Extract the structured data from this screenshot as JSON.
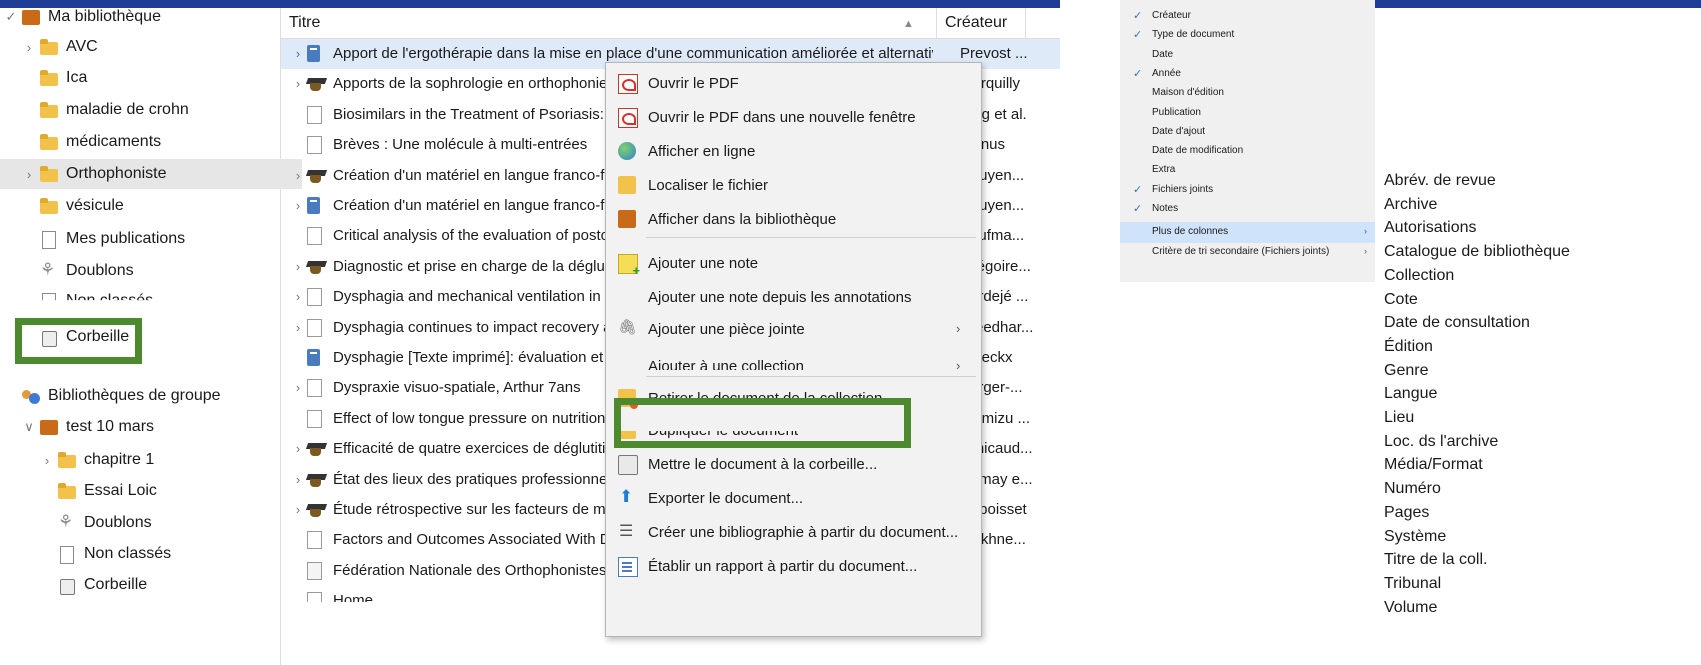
{
  "sidebar": {
    "items": [
      {
        "label": "Ma bibliothèque",
        "icon": "library-icon",
        "twisty": "✓"
      },
      {
        "label": "AVC",
        "icon": "folder-icon",
        "twisty": "›"
      },
      {
        "label": "Ica",
        "icon": "folder-icon",
        "twisty": ""
      },
      {
        "label": "maladie de crohn",
        "icon": "folder-icon",
        "twisty": ""
      },
      {
        "label": "médicaments",
        "icon": "folder-icon",
        "twisty": ""
      },
      {
        "label": "Orthophoniste",
        "icon": "folder-icon",
        "twisty": "›"
      },
      {
        "label": "vésicule",
        "icon": "folder-icon",
        "twisty": ""
      },
      {
        "label": "Mes publications",
        "icon": "document-icon",
        "twisty": ""
      },
      {
        "label": "Doublons",
        "icon": "duplicates-icon",
        "twisty": ""
      },
      {
        "label": "Non classés",
        "icon": "unfiled-icon",
        "twisty": ""
      },
      {
        "label": "Corbeille",
        "icon": "trash-icon",
        "twisty": ""
      },
      {
        "label": "Bibliothèques de groupe",
        "icon": "group-icon",
        "twisty": ""
      },
      {
        "label": "test 10 mars",
        "icon": "library-icon",
        "twisty": "∨"
      },
      {
        "label": "chapitre 1",
        "icon": "folder-icon",
        "twisty": "›"
      },
      {
        "label": "Essai Loic",
        "icon": "folder-icon",
        "twisty": ""
      },
      {
        "label": "Doublons",
        "icon": "duplicates-icon",
        "twisty": ""
      },
      {
        "label": "Non classés",
        "icon": "unfiled-icon",
        "twisty": ""
      },
      {
        "label": "Corbeille",
        "icon": "trash-icon",
        "twisty": ""
      }
    ]
  },
  "list": {
    "columns": {
      "title": "Titre",
      "creator": "Créateur",
      "sort_icon": "▲"
    },
    "rows": [
      {
        "title": "Apport de l'ergothérapie dans la mise en place d'une communication améliorée et alternative chez les pa...",
        "mid": "",
        "creator": "Prevost ...",
        "icon": "book"
      },
      {
        "title": "Apports de la sophrologie en orthophonie :",
        "mid": "",
        "creator": "Marquilly",
        "icon": "thesis"
      },
      {
        "title": "Biosimilars in the Treatment of Psoriasis: Ar",
        "mid": "",
        "creator": "Puig et al.",
        "icon": "doc"
      },
      {
        "title": "Brèves : Une molécule à multi-entrées",
        "mid": "",
        "creator": "Manus",
        "icon": "doc"
      },
      {
        "title": "Création d'un matériel en langue franco-fra",
        "mid": "s...",
        "creator": "Nguyen...",
        "icon": "thesis"
      },
      {
        "title": "Création d'un matériel en langue franco-fra",
        "mid": "s...",
        "creator": "Nguyen...",
        "icon": "book"
      },
      {
        "title": "Critical analysis of the evaluation of postop",
        "mid": "a...",
        "creator": "Kaufma...",
        "icon": "doc"
      },
      {
        "title": "Diagnostic et prise en charge de la dégluti",
        "mid": "u...",
        "creator": "Grégoire...",
        "icon": "thesis"
      },
      {
        "title": "Dysphagia and mechanical ventilation in SA",
        "mid": "",
        "creator": "Bordejé ...",
        "icon": "doc"
      },
      {
        "title": "Dysphagia continues to impact recovery at",
        "mid": "",
        "creator": "Sreedhar...",
        "icon": "doc"
      },
      {
        "title": "Dysphagie [Texte imprimé]: évaluation et ré",
        "mid": "",
        "creator": "Bleeckx",
        "icon": "book"
      },
      {
        "title": "Dyspraxie visuo-spatiale, Arthur 7ans",
        "mid": "",
        "creator": "Berger-...",
        "icon": "doc"
      },
      {
        "title": "Effect of low tongue pressure on nutritiona",
        "mid": "en...",
        "creator": "Shimizu ...",
        "icon": "doc"
      },
      {
        "title": "Efficacité de quatre exercices de déglutition",
        "mid": "",
        "creator": "Janicaud...",
        "icon": "thesis"
      },
      {
        "title": "État des lieux des pratiques professionnelle",
        "mid": "",
        "creator": "Demay e...",
        "icon": "thesis"
      },
      {
        "title": "Étude rétrospective sur les facteurs de mau",
        "mid": "n...",
        "creator": "Duboisset",
        "icon": "thesis"
      },
      {
        "title": "Factors and Outcomes Associated With Dy:",
        "mid": "",
        "creator": "Makhne...",
        "icon": "doc"
      },
      {
        "title": "Fédération Nationale des Orthophonistes –",
        "mid": "os ...",
        "creator": "",
        "icon": "web"
      },
      {
        "title": "Home",
        "mid": "",
        "creator": "",
        "icon": "doc"
      }
    ]
  },
  "context_menu": {
    "items": [
      {
        "label": "Ouvrir le PDF",
        "icon": "pdf-icon",
        "submenu": false
      },
      {
        "label": "Ouvrir le PDF dans une nouvelle fenêtre",
        "icon": "pdf-icon",
        "submenu": false
      },
      {
        "label": "Afficher en ligne",
        "icon": "globe-icon",
        "submenu": false
      },
      {
        "label": "Localiser le fichier",
        "icon": "folder-icon",
        "submenu": false
      },
      {
        "label": "Afficher dans la bibliothèque",
        "icon": "library-icon",
        "submenu": false
      },
      {
        "label": "Ajouter une note",
        "icon": "note-add-icon",
        "submenu": false
      },
      {
        "label": "Ajouter une note depuis les annotations",
        "icon": "",
        "submenu": false
      },
      {
        "label": "Ajouter une pièce jointe",
        "icon": "paperclip-icon",
        "submenu": true
      },
      {
        "label": "Ajouter à une collection",
        "icon": "",
        "submenu": true
      },
      {
        "label": "Retirer le document de la collection...",
        "icon": "remove-from-collection-icon",
        "submenu": false
      },
      {
        "label": "Dupliquer le document",
        "icon": "duplicate-icon",
        "submenu": false
      },
      {
        "label": "Mettre le document à la corbeille...",
        "icon": "trash-icon",
        "submenu": false
      },
      {
        "label": "Exporter le document...",
        "icon": "export-icon",
        "submenu": false
      },
      {
        "label": "Créer une bibliographie à partir du document...",
        "icon": "bibliography-icon",
        "submenu": false
      },
      {
        "label": "Établir un rapport à partir du document...",
        "icon": "report-icon",
        "submenu": false
      }
    ],
    "submenu_arrow": "›"
  },
  "column_chooser": {
    "items": [
      {
        "label": "Créateur",
        "checked": true
      },
      {
        "label": "Type de document",
        "checked": true
      },
      {
        "label": "Date",
        "checked": false
      },
      {
        "label": "Année",
        "checked": true
      },
      {
        "label": "Maison d'édition",
        "checked": false
      },
      {
        "label": "Publication",
        "checked": false
      },
      {
        "label": "Date d'ajout",
        "checked": false
      },
      {
        "label": "Date de modification",
        "checked": false
      },
      {
        "label": "Extra",
        "checked": false
      },
      {
        "label": "Fichiers joints",
        "checked": true
      },
      {
        "label": "Notes",
        "checked": true
      },
      {
        "label": "Plus de colonnes",
        "checked": false,
        "submenu": true,
        "selected": true
      },
      {
        "label": "Critère de tri secondaire (Fichiers joints)",
        "checked": false,
        "submenu": true
      }
    ],
    "check_glyph": "✓"
  },
  "more_columns": {
    "items": [
      "Abrév. de revue",
      "Archive",
      "Autorisations",
      "Catalogue de bibliothèque",
      "Collection",
      "Cote",
      "Date de consultation",
      "Édition",
      "Genre",
      "Langue",
      "Lieu",
      "Loc. ds l'archive",
      "Média/Format",
      "Numéro",
      "Pages",
      "Système",
      "Titre de la coll.",
      "Tribunal",
      "Volume"
    ]
  },
  "colors": {
    "banner": "#1f3d95",
    "highlight_box": "#4d8a2f",
    "selection": "#dfeaf9",
    "check": "#3574b8"
  }
}
